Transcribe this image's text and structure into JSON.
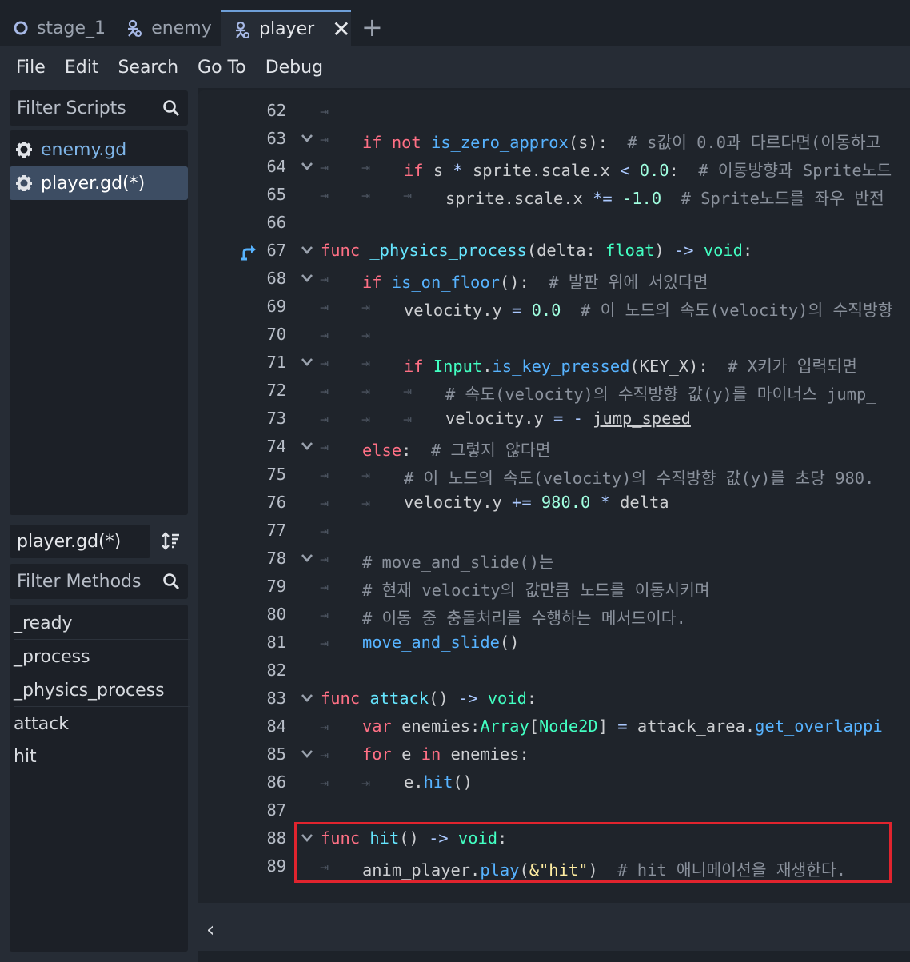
{
  "tabs": [
    {
      "label": "stage_1",
      "icon": "circle-node-icon",
      "active": false
    },
    {
      "label": "enemy",
      "icon": "character-node-icon",
      "active": false
    },
    {
      "label": "player",
      "icon": "character-node-icon",
      "active": true
    }
  ],
  "tab_close": "✕",
  "tab_add": "+",
  "menu": [
    "File",
    "Edit",
    "Search",
    "Go To",
    "Debug"
  ],
  "scripts_filter": {
    "placeholder": "Filter Scripts"
  },
  "scripts": [
    {
      "name": "enemy.gd",
      "selected": false
    },
    {
      "name": "player.gd(*)",
      "selected": true
    }
  ],
  "current_script": "player.gd(*)",
  "methods_filter": {
    "placeholder": "Filter Methods"
  },
  "methods": [
    "_ready",
    "_process",
    "_physics_process",
    "attack",
    "hit"
  ],
  "colors": {
    "accent": "#6e9fd8",
    "highlight_box": "#e0242e",
    "keyword": "#ff7085",
    "function": "#57b3ff",
    "type": "#42ffc2",
    "number": "#a1ffe0",
    "comment": "#8a919c",
    "string": "#ffeda1"
  },
  "line_numbers": [
    "62",
    "63",
    "64",
    "65",
    "66",
    "67",
    "68",
    "69",
    "70",
    "71",
    "72",
    "73",
    "74",
    "75",
    "76",
    "77",
    "78",
    "79",
    "80",
    "81",
    "82",
    "83",
    "84",
    "85",
    "86",
    "87",
    "88",
    "89"
  ],
  "code": {
    "l63a": "if",
    "l63b": "not",
    "l63c": "is_zero_approx",
    "l63d": "(s):",
    "l63e": "# s값이 0.0과 다르다면(이동하고",
    "l64a": "if",
    "l64b": "s",
    "l64c": "*",
    "l64d": "sprite.scale.x",
    "l64e": "<",
    "l64f": "0.0",
    "l64g": ":",
    "l64h": "# 이동방향과 Sprite노드",
    "l65a": "sprite.scale.x",
    "l65b": "*=",
    "l65c": "-1.0",
    "l65d": "# Sprite노드를 좌우 반전",
    "l67a": "func",
    "l67b": "_physics_process",
    "l67c": "(delta:",
    "l67d": "float",
    "l67e": ")",
    "l67f": "->",
    "l67g": "void",
    "l67h": ":",
    "l68a": "if",
    "l68b": "is_on_floor",
    "l68c": "():",
    "l68d": "# 발판 위에 서있다면",
    "l69a": "velocity.y",
    "l69b": "=",
    "l69c": "0.0",
    "l69d": "# 이 노드의 속도(velocity)의 수직방향",
    "l71a": "if",
    "l71b": "Input",
    "l71c": ".",
    "l71d": "is_key_pressed",
    "l71e": "(KEY_X):",
    "l71f": "# X키가 입력되면",
    "l72a": "# 속도(velocity)의 수직방향 값(y)를 마이너스 jump_",
    "l73a": "velocity.y",
    "l73b": "=",
    "l73c": "-",
    "l73d": "jump_speed",
    "l74a": "else",
    "l74b": ":",
    "l74c": "# 그렇지 않다면",
    "l75a": "# 이 노드의 속도(velocity)의 수직방향 값(y)를 초당 980.",
    "l76a": "velocity.y",
    "l76b": "+=",
    "l76c": "980.0",
    "l76d": "*",
    "l76e": "delta",
    "l78a": "# move_and_slide()는",
    "l79a": "# 현재 velocity의 값만큼 노드를 이동시키며",
    "l80a": "# 이동 중 충돌처리를 수행하는 메서드이다.",
    "l81a": "move_and_slide",
    "l81b": "()",
    "l83a": "func",
    "l83b": "attack",
    "l83c": "()",
    "l83d": "->",
    "l83e": "void",
    "l83f": ":",
    "l84a": "var",
    "l84b": "enemies:",
    "l84c": "Array",
    "l84d": "[",
    "l84e": "Node2D",
    "l84f": "]",
    "l84g": "=",
    "l84h": "attack_area.",
    "l84i": "get_overlappi",
    "l85a": "for",
    "l85b": "e",
    "l85c": "in",
    "l85d": "enemies:",
    "l86a": "e.",
    "l86b": "hit",
    "l86c": "()",
    "l88a": "func",
    "l88b": "hit",
    "l88c": "()",
    "l88d": "->",
    "l88e": "void",
    "l88f": ":",
    "l89a": "anim_player.",
    "l89b": "play",
    "l89c": "(",
    "l89d": "&\"hit\"",
    "l89e": ")",
    "l89f": "# hit 애니메이션을 재생한다."
  },
  "bottom_chevron": "‹"
}
